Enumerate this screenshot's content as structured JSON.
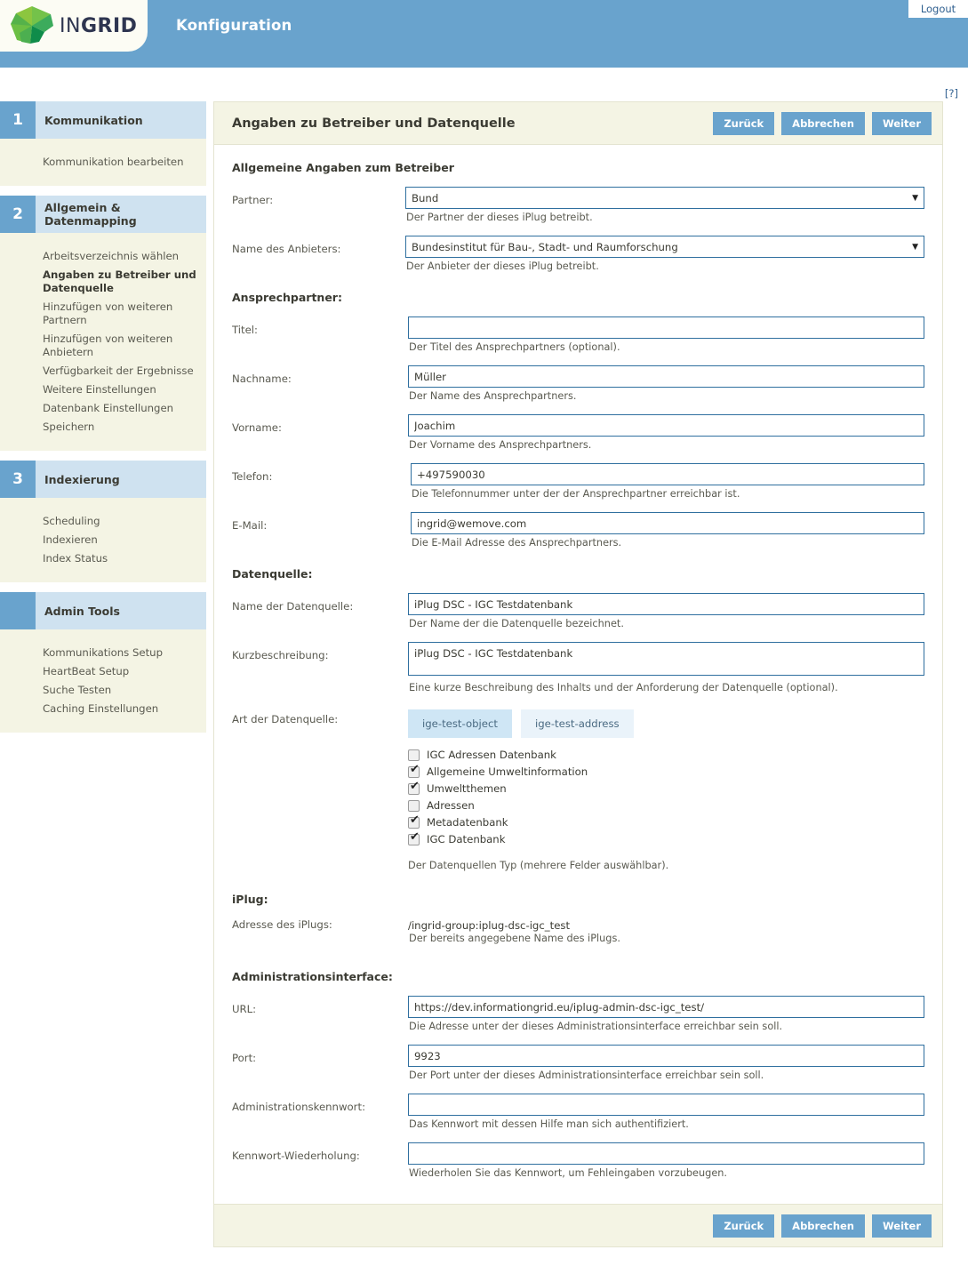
{
  "header": {
    "app_title": "Konfiguration",
    "logo_text_light": "IN",
    "logo_text_bold": "GRID",
    "logout_label": "Logout",
    "help_label": "[?]",
    "brand_blue": "#69a3cd",
    "logo_green": "#4fae4f"
  },
  "sidebar": {
    "groups": [
      {
        "number": "1",
        "title": "Kommunikation",
        "items": [
          {
            "label": "Kommunikation bearbeiten",
            "active": false
          }
        ]
      },
      {
        "number": "2",
        "title": "Allgemein & Datenmapping",
        "items": [
          {
            "label": "Arbeitsverzeichnis wählen",
            "active": false
          },
          {
            "label": "Angaben zu Betreiber und Datenquelle",
            "active": true
          },
          {
            "label": "Hinzufügen von weiteren Partnern",
            "active": false
          },
          {
            "label": "Hinzufügen von weiteren Anbietern",
            "active": false
          },
          {
            "label": "Verfügbarkeit der Ergebnisse",
            "active": false
          },
          {
            "label": "Weitere Einstellungen",
            "active": false
          },
          {
            "label": "Datenbank Einstellungen",
            "active": false
          },
          {
            "label": "Speichern",
            "active": false
          }
        ]
      },
      {
        "number": "3",
        "title": "Indexierung",
        "items": [
          {
            "label": "Scheduling",
            "active": false
          },
          {
            "label": "Indexieren",
            "active": false
          },
          {
            "label": "Index Status",
            "active": false
          }
        ]
      },
      {
        "number": "",
        "title": "Admin Tools",
        "items": [
          {
            "label": "Kommunikations Setup",
            "active": false
          },
          {
            "label": "HeartBeat Setup",
            "active": false
          },
          {
            "label": "Suche Testen",
            "active": false
          },
          {
            "label": "Caching Einstellungen",
            "active": false
          }
        ]
      }
    ]
  },
  "panel": {
    "title": "Angaben zu Betreiber und Datenquelle",
    "buttons": {
      "back": "Zurück",
      "cancel": "Abbrechen",
      "next": "Weiter"
    },
    "sections": {
      "operator": "Allgemeine Angaben zum Betreiber",
      "contact": "Ansprechpartner:",
      "datasource": "Datenquelle:",
      "iplug": "iPlug:",
      "admin_interface": "Administrationsinterface:"
    },
    "fields": {
      "partner": {
        "label": "Partner:",
        "value": "Bund",
        "hint": "Der Partner der dieses iPlug betreibt."
      },
      "provider": {
        "label": "Name des Anbieters:",
        "value": "Bundesinstitut für Bau-, Stadt- und Raumforschung",
        "hint": "Der Anbieter der dieses iPlug betreibt."
      },
      "title": {
        "label": "Titel:",
        "value": "",
        "placeholder": "",
        "hint": "Der Titel des Ansprechpartners (optional)."
      },
      "lastname": {
        "label": "Nachname:",
        "value": "Müller",
        "placeholder": "",
        "hint": "Der Name des Ansprechpartners."
      },
      "firstname": {
        "label": "Vorname:",
        "value": "Joachim",
        "placeholder": "",
        "hint": "Der Vorname des Ansprechpartners."
      },
      "phone": {
        "label": "Telefon:",
        "value": "+497590030",
        "placeholder": "",
        "hint": "Die Telefonnummer unter der der Ansprechpartner erreichbar ist."
      },
      "email": {
        "label": "E-Mail:",
        "value": "ingrid@wemove.com",
        "placeholder": "",
        "hint": "Die E-Mail Adresse des Ansprechpartners."
      },
      "ds_name": {
        "label": "Name der Datenquelle:",
        "value": "iPlug DSC - IGC Testdatenbank",
        "placeholder": "",
        "hint": "Der Name der die Datenquelle bezeichnet."
      },
      "ds_desc": {
        "label": "Kurzbeschreibung:",
        "value": "iPlug DSC - IGC Testdatenbank",
        "placeholder": "",
        "hint": "Eine kurze Beschreibung des Inhalts und der Anforderung der Datenquelle (optional)."
      },
      "ds_type": {
        "label": "Art der Datenquelle:",
        "hint": "Der Datenquellen Typ (mehrere Felder auswählbar)."
      },
      "iplug_address": {
        "label": "Adresse des iPlugs:",
        "value": "/ingrid-group:iplug-dsc-igc_test",
        "hint": "Der bereits angegebene Name des iPlugs."
      },
      "url": {
        "label": "URL:",
        "value": "https://dev.informationgrid.eu/iplug-admin-dsc-igc_test/",
        "placeholder": "",
        "hint": "Die Adresse unter der dieses Administrationsinterface erreichbar sein soll."
      },
      "port": {
        "label": "Port:",
        "value": "9923",
        "placeholder": "",
        "hint": "Der Port unter der dieses Administrationsinterface erreichbar sein soll."
      },
      "admin_password": {
        "label": "Administrationskennwort:",
        "value": "",
        "placeholder": "",
        "hint": "Das Kennwort mit dessen Hilfe man sich authentifiziert."
      },
      "password_repeat": {
        "label": "Kennwort-Wiederholung:",
        "value": "",
        "placeholder": "",
        "hint": "Wiederholen Sie das Kennwort, um Fehleingaben vorzubeugen."
      }
    },
    "datasource_tabs": [
      {
        "label": "ige-test-object",
        "selected": true
      },
      {
        "label": "ige-test-address",
        "selected": false
      }
    ],
    "datasource_checkboxes": [
      {
        "label": "IGC Adressen Datenbank",
        "checked": false
      },
      {
        "label": "Allgemeine Umweltinformation",
        "checked": true
      },
      {
        "label": "Umweltthemen",
        "checked": true
      },
      {
        "label": "Adressen",
        "checked": false
      },
      {
        "label": "Metadatenbank",
        "checked": true
      },
      {
        "label": "IGC Datenbank",
        "checked": true
      }
    ]
  }
}
